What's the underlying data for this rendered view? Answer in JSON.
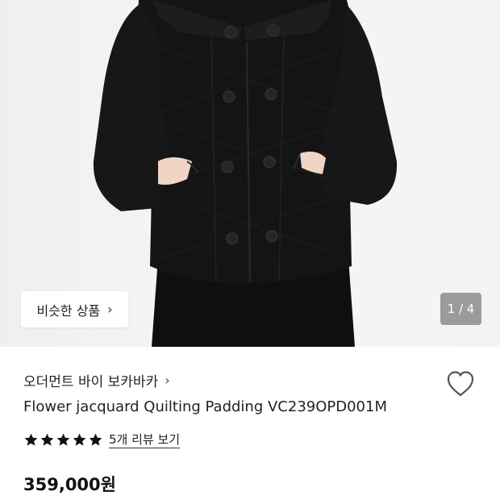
{
  "gallery": {
    "similar_button_label": "비슷한 상품",
    "pager_text": "1 / 4",
    "colors": {
      "background": "#f1f1f1",
      "coat": "#121212",
      "blouse": "#e9ddd3"
    }
  },
  "product": {
    "brand": "오더먼트 바이 보카바카",
    "title": "Flower jacquard Quilting Padding VC239OPD001M",
    "rating": {
      "stars": 5,
      "review_link": "5개 리뷰 보기"
    },
    "price": "359,000원",
    "icons": {
      "wishlist": "heart-outline-icon",
      "rating": "star-filled-icon",
      "chevron": "chevron-right-icon"
    }
  }
}
